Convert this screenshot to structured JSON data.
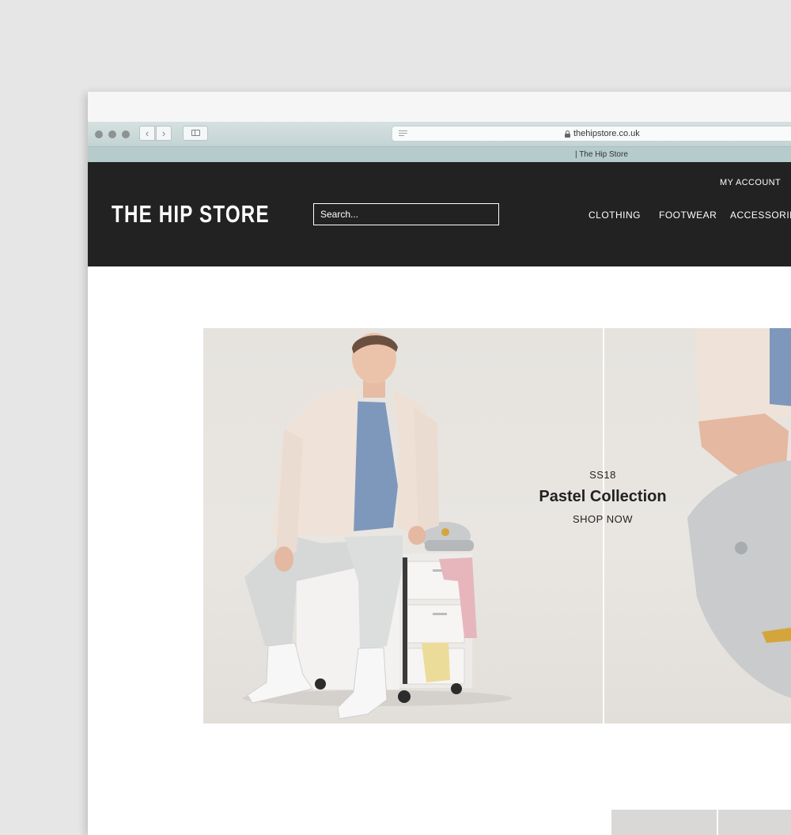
{
  "browser": {
    "url": "thehipstore.co.uk",
    "tab_title": "| The Hip Store",
    "back_icon": "chevron-left-icon",
    "forward_icon": "chevron-right-icon"
  },
  "site": {
    "logo": "THE HIP STORE",
    "search_placeholder": "Search...",
    "account_link": "MY ACCOUNT",
    "nav": [
      "CLOTHING",
      "FOOTWEAR",
      "ACCESSORIES"
    ]
  },
  "hero": {
    "season": "SS18",
    "title": "Pastel Collection",
    "cta": "SHOP NOW"
  },
  "colors": {
    "header_bg": "#222222",
    "page_bg": "#e6e6e6",
    "toolbar_bg": "#c3d3d3",
    "hero_bg": "#e6e3df"
  }
}
